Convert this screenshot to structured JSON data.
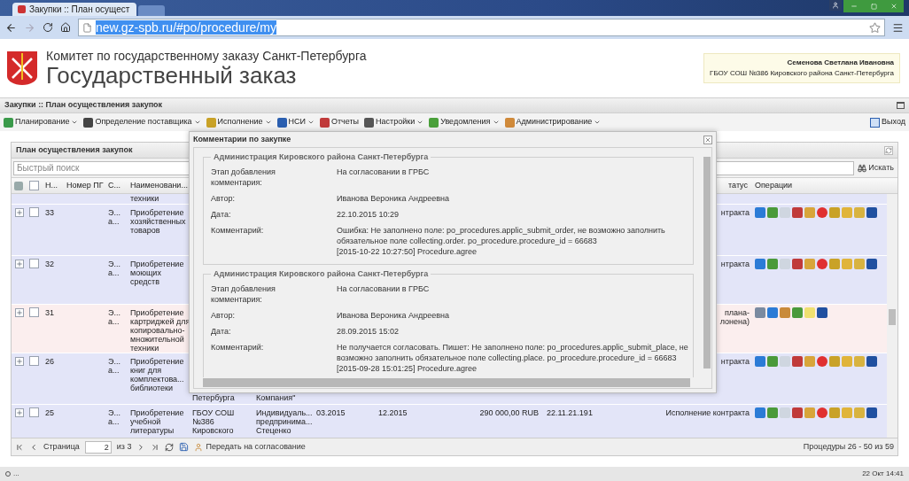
{
  "browser": {
    "tab_title": "Закупки :: План осущест",
    "url": "new.gz-spb.ru/#po/procedure/my"
  },
  "header": {
    "org": "Комитет по государственному заказу Санкт-Петербурга",
    "title": "Государственный заказ",
    "user": {
      "name": "Семенова Светлана Ивановна",
      "org": "ГБОУ СОШ №386 Кировского района Санкт-Петербурга"
    }
  },
  "section_title": "Закупки :: План осуществления закупок",
  "menu": [
    {
      "label": "Планирование",
      "dropdown": true
    },
    {
      "label": "Определение поставщика",
      "dropdown": true
    },
    {
      "label": "Исполнение",
      "dropdown": true
    },
    {
      "label": "НСИ",
      "dropdown": true
    },
    {
      "label": "Отчеты",
      "dropdown": false
    },
    {
      "label": "Настройки",
      "dropdown": true
    },
    {
      "label": "Уведомления",
      "dropdown": true
    },
    {
      "label": "Администрирование",
      "dropdown": true
    }
  ],
  "logout": "Выход",
  "panel": {
    "title": "План осуществления закупок",
    "search": {
      "placeholder": "Быстрый поиск",
      "button": "Искать"
    },
    "select_all": {
      "checked": false
    },
    "columns": {
      "number": "Н...",
      "plan_number": "Номер ПГ",
      "column_3": "С...",
      "name": "Наименовани...",
      "status": "татус",
      "operations": "Операции"
    },
    "rows": [
      {
        "kind": "partial",
        "name": "техники"
      },
      {
        "kind": "contract",
        "checked": false,
        "number": "33",
        "column_3": "Э...\nа...",
        "name": "Приобретение\nхозяйственных\nтоваров",
        "status": "нтракта"
      },
      {
        "kind": "contract",
        "checked": false,
        "number": "32",
        "column_3": "Э...\nа...",
        "name": "Приобретение\nмоющих\nсредств",
        "status": "нтракта"
      },
      {
        "kind": "plan",
        "checked": false,
        "number": "31",
        "column_3": "Э...\nа...",
        "name": "Приобретение\nкартриджей для\nкопировально-\nмножительной\nтехники",
        "status": "плана-\nлонена)"
      },
      {
        "kind": "contract",
        "checked": false,
        "number": "26",
        "column_3": "Э...\nа...",
        "name": "Приобретение\nкниг для\nкомплектова...\nбиблиотеки",
        "customer": "Петербурга",
        "supplier": "Компания\"",
        "status": "нтракта"
      },
      {
        "kind": "contract",
        "checked": false,
        "number": "25",
        "column_3": "Э...\nа...",
        "name": "Приобретение\nучебной\nлитературы",
        "customer": "ГБОУ СОШ\n№386\nКировского",
        "supplier": "Индивидуаль...\nпредпринима...\nСтеценко",
        "start": "03.2015",
        "end": "12.2015",
        "sum": "290 000,00 RUB",
        "okpd": "22.11.21.191",
        "status": "Исполнение контракта"
      }
    ],
    "pager": {
      "page_label": "Страница",
      "page": "2",
      "of": "из 3",
      "send": "Передать на согласование",
      "summary": "Процедуры 26 - 50 из 59"
    }
  },
  "dialog": {
    "title": "Комментарии по закупке",
    "comments": [
      {
        "org": "Администрация Кировского района Санкт-Петербурга",
        "fields": [
          {
            "label": "Этап добавления\nкомментария:",
            "value": "На согласовании в ГРБС"
          },
          {
            "label": "Автор:",
            "value": "Иванова Вероника Андреевна"
          },
          {
            "label": "Дата:",
            "value": "22.10.2015 10:29"
          },
          {
            "label": "Комментарий:",
            "value": "Ошибка: Не заполнено поле: po_procedures.applic_submit_order, не возможно заполнить\nобязательное поле collecting.order. po_procedure.procedure_id = 66683\n[2015-10-22 10:27:50] Procedure.agree"
          }
        ]
      },
      {
        "org": "Администрация Кировского района Санкт-Петербурга",
        "fields": [
          {
            "label": "Этап добавления\nкомментария:",
            "value": "На согласовании в ГРБС"
          },
          {
            "label": "Автор:",
            "value": "Иванова Вероника Андреевна"
          },
          {
            "label": "Дата:",
            "value": "28.09.2015 15:02"
          },
          {
            "label": "Комментарий:",
            "value": "Не получается согласовать. Пишет: Не заполнено поле: po_procedures.applic_submit_place, не\nвозможно заполнить обязательное поле collecting.place. po_procedure.procedure_id = 66683\n[2015-09-28 15:01:25] Procedure.agree"
          }
        ]
      }
    ]
  },
  "status_bar": {
    "left": "...",
    "time": "22 Окт 14:41"
  }
}
